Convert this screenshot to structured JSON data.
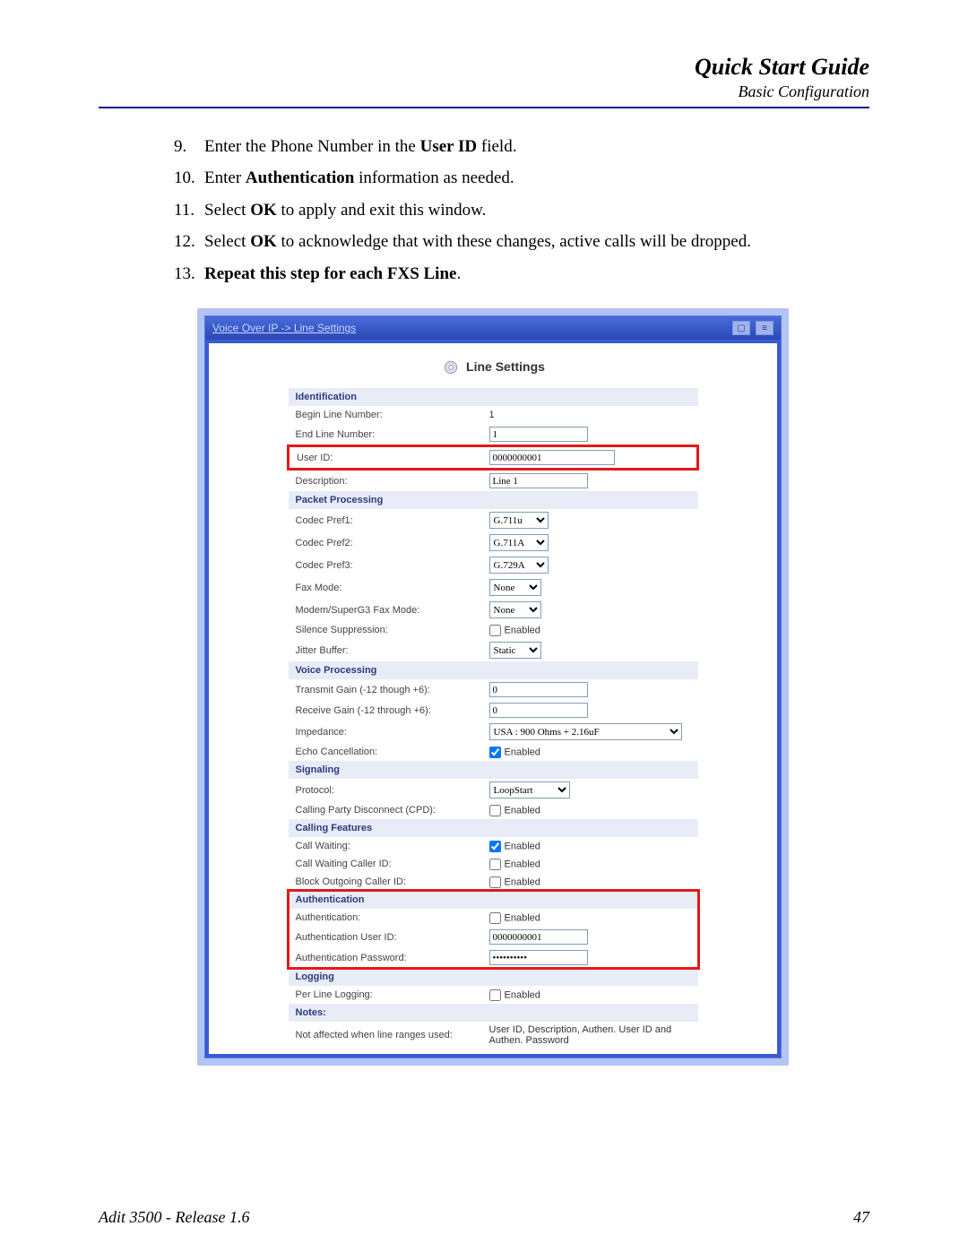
{
  "header": {
    "guide_title": "Quick Start Guide",
    "guide_sub": "Basic Configuration"
  },
  "steps": {
    "step9_a": "Enter the Phone Number in the ",
    "step9_b": "User ID",
    "step9_c": " field.",
    "step10_a": "Enter ",
    "step10_b": "Authentication",
    "step10_c": " information as needed.",
    "step11_a": "Select ",
    "step11_b": "OK",
    "step11_c": " to apply and exit this window.",
    "step12_a": "Select ",
    "step12_b": "OK",
    "step12_c": " to acknowledge that with these changes, active calls will be dropped.",
    "step13": "Repeat this step for each FXS Line"
  },
  "shot": {
    "breadcrumb": "Voice Over IP -> Line Settings",
    "panel_title": "Line Settings",
    "sections": {
      "identification": "Identification",
      "packet": "Packet Processing",
      "voice": "Voice Processing",
      "signaling": "Signaling",
      "calling": "Calling Features",
      "auth": "Authentication",
      "logging": "Logging",
      "notes": "Notes:"
    },
    "labels": {
      "begin_line": "Begin Line Number:",
      "end_line": "End Line Number:",
      "user_id": "User ID:",
      "description": "Description:",
      "codec1": "Codec Pref1:",
      "codec2": "Codec Pref2:",
      "codec3": "Codec Pref3:",
      "fax": "Fax Mode:",
      "modem": "Modem/SuperG3 Fax Mode:",
      "silence": "Silence Suppression:",
      "jitter": "Jitter Buffer:",
      "tx_gain": "Transmit Gain (-12 though +6):",
      "rx_gain": "Receive Gain (-12 through +6):",
      "impedance": "Impedance:",
      "echo": "Echo Cancellation:",
      "protocol": "Protocol:",
      "cpd": "Calling Party Disconnect (CPD):",
      "call_wait": "Call Waiting:",
      "cw_cid": "Call Waiting Caller ID:",
      "block_cid": "Block Outgoing Caller ID:",
      "auth_en": "Authentication:",
      "auth_uid": "Authentication User ID:",
      "auth_pw": "Authentication Password:",
      "per_line_log": "Per Line Logging:",
      "note_line": "Not affected when line ranges used:"
    },
    "values": {
      "begin_line": "1",
      "end_line": "1",
      "user_id": "0000000001",
      "description": "Line 1",
      "codec1": "G.711u",
      "codec2": "G.711A",
      "codec3": "G.729A",
      "fax": "None",
      "modem": "None",
      "jitter": "Static",
      "tx_gain": "0",
      "rx_gain": "0",
      "impedance": "USA : 900 Ohms + 2.16uF",
      "protocol": "LoopStart",
      "auth_uid": "0000000001",
      "auth_pw": "••••••••••",
      "enabled": "Enabled",
      "notes_text": "User ID, Description, Authen. User ID and Authen. Password"
    },
    "checks": {
      "silence": false,
      "echo": true,
      "cpd": false,
      "call_wait": true,
      "cw_cid": false,
      "block_cid": false,
      "auth_en": false,
      "per_line_log": false
    }
  },
  "footer": {
    "left": "Adit 3500  - Release 1.6",
    "right": "47"
  }
}
